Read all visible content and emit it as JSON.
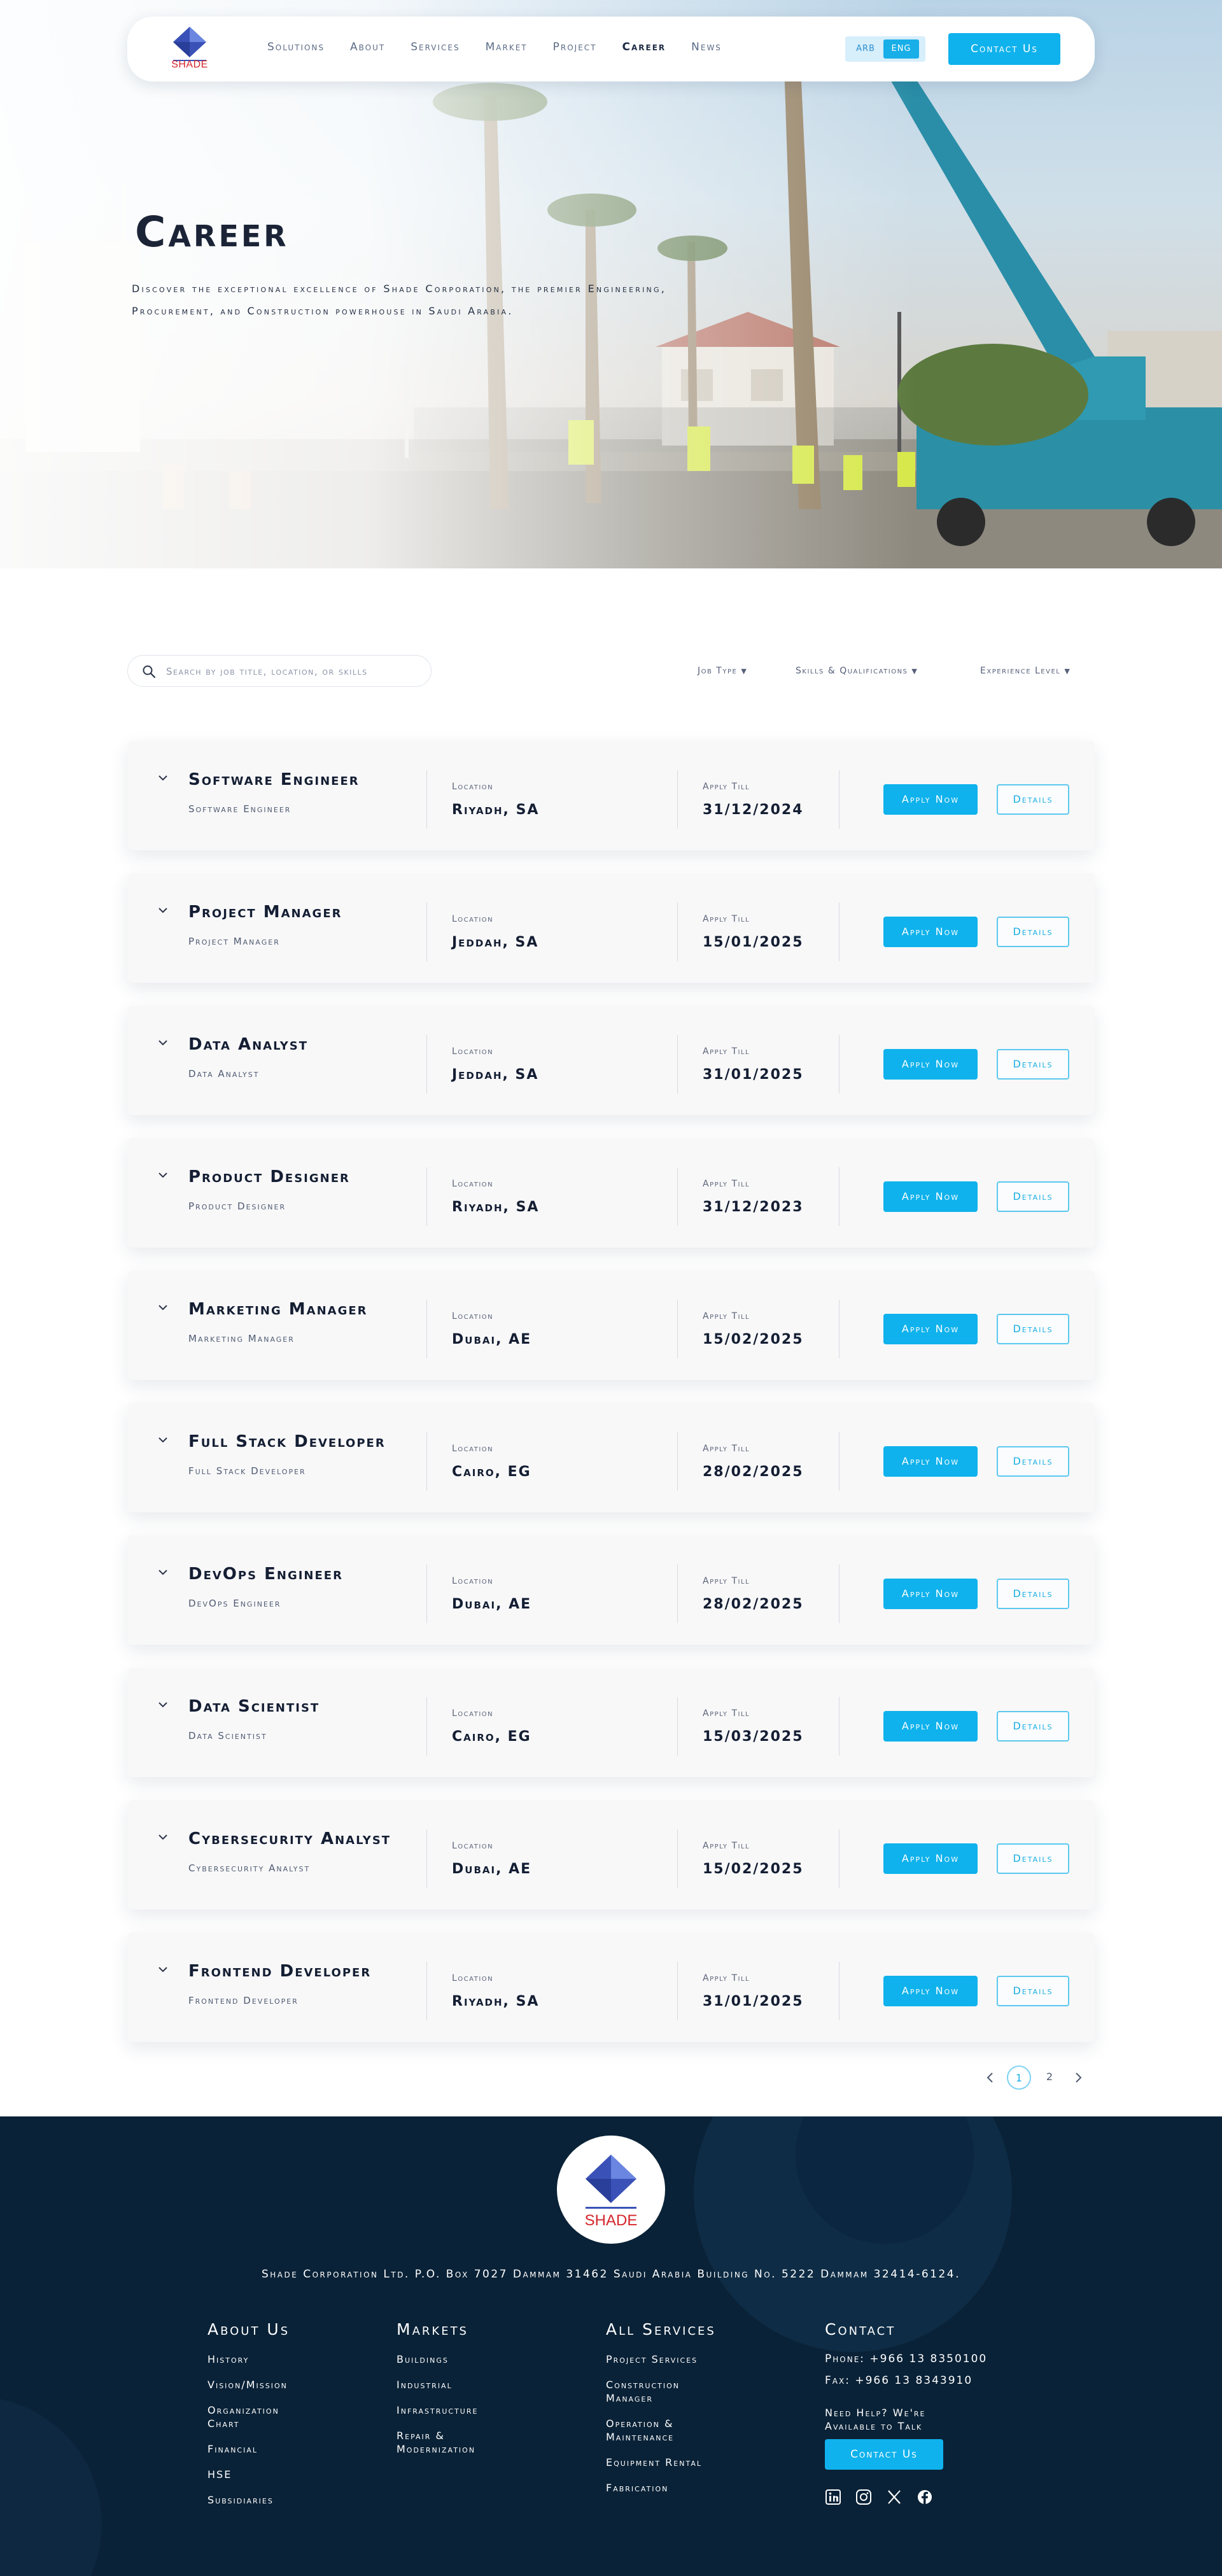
{
  "nav": {
    "logo_text": "SHADE",
    "links": [
      "Solutions",
      "About",
      "Services",
      "Market",
      "Project",
      "Career",
      "News"
    ],
    "active": "Career",
    "lang": {
      "ar": "ARB",
      "en": "ENG",
      "active": "ENG"
    },
    "contact_label": "Contact Us"
  },
  "hero": {
    "title": "Career",
    "description": "Discover the exceptional excellence of Shade Corporation, the premier Engineering, Procurement, and Construction powerhouse in Saudi Arabia."
  },
  "filters": {
    "search_placeholder": "Search by job title, location, or skills",
    "dropdowns": [
      "Job Type",
      "Skills & Qualifications",
      "Experience Level"
    ]
  },
  "labels": {
    "location": "Location",
    "apply_till": "Apply Till",
    "apply_btn": "Apply Now",
    "details_btn": "Details"
  },
  "jobs": [
    {
      "title": "Software Engineer",
      "subtitle": "Software Engineer",
      "location": "Riyadh, SA",
      "apply_till": "31/12/2024"
    },
    {
      "title": "Project Manager",
      "subtitle": "Project Manager",
      "location": "Jeddah, SA",
      "apply_till": "15/01/2025"
    },
    {
      "title": "Data Analyst",
      "subtitle": "Data Analyst",
      "location": "Jeddah, SA",
      "apply_till": "31/01/2025"
    },
    {
      "title": "Product Designer",
      "subtitle": "Product Designer",
      "location": "Riyadh, SA",
      "apply_till": "31/12/2023"
    },
    {
      "title": "Marketing Manager",
      "subtitle": "Marketing Manager",
      "location": "Dubai, AE",
      "apply_till": "15/02/2025"
    },
    {
      "title": "Full Stack Developer",
      "subtitle": "Full Stack Developer",
      "location": "Cairo, EG",
      "apply_till": "28/02/2025"
    },
    {
      "title": "DevOps Engineer",
      "subtitle": "DevOps Engineer",
      "location": "Dubai, AE",
      "apply_till": "28/02/2025"
    },
    {
      "title": "Data Scientist",
      "subtitle": "Data Scientist",
      "location": "Cairo, EG",
      "apply_till": "15/03/2025"
    },
    {
      "title": "Cybersecurity Analyst",
      "subtitle": "Cybersecurity Analyst",
      "location": "Dubai, AE",
      "apply_till": "15/02/2025"
    },
    {
      "title": "Frontend Developer",
      "subtitle": "Frontend Developer",
      "location": "Riyadh, SA",
      "apply_till": "31/01/2025"
    }
  ],
  "pagination": {
    "pages": [
      "1",
      "2"
    ],
    "current": "1"
  },
  "footer": {
    "logo_text": "SHADE",
    "address": "Shade Corporation Ltd. P.O. Box 7027 Dammam 31462 Saudi Arabia Building No. 5222 Dammam 32414-6124.",
    "about": {
      "heading": "About Us",
      "links": [
        "History",
        "Vision/Mission",
        "Organization Chart",
        "Financial",
        "HSE",
        "Subsidiaries"
      ]
    },
    "markets": {
      "heading": "Markets",
      "links": [
        "Buildings",
        "Industrial",
        "Infrastructure",
        "Repair & Modernization"
      ]
    },
    "services": {
      "heading": "All Services",
      "links": [
        "Project Services",
        "Construction Manager",
        "Operation & Maintenance",
        "Equipment Rental",
        "Fabrication"
      ]
    },
    "contact": {
      "heading": "Contact",
      "phone": "Phone: +966 13 8350100",
      "fax": "Fax: +966 13 8343910",
      "help": "Need Help? We're Available to Talk",
      "button": "Contact Us",
      "socials": [
        "linkedin-icon",
        "instagram-icon",
        "x-icon",
        "facebook-icon"
      ]
    }
  },
  "colors": {
    "accent": "#0fb2ec",
    "footer_bg": "#0a2237",
    "text_dark": "#141e33",
    "brand_red": "#d4262c"
  }
}
